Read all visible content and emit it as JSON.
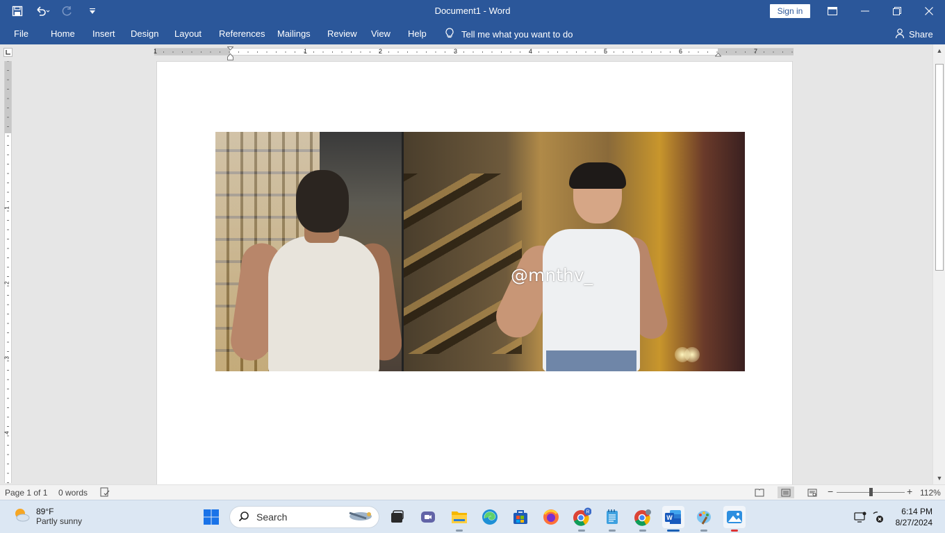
{
  "window": {
    "title": "Document1  -  Word",
    "sign_in": "Sign in"
  },
  "ribbon": {
    "tabs": [
      "File",
      "Home",
      "Insert",
      "Design",
      "Layout",
      "References",
      "Mailings",
      "Review",
      "View",
      "Help"
    ],
    "tell_me": "Tell me what you want to do",
    "share": "Share"
  },
  "ruler": {
    "h_labels": [
      "1",
      "1",
      "2",
      "3",
      "4",
      "5",
      "6",
      "7"
    ],
    "v_labels": [
      "1",
      "2",
      "3",
      "4"
    ]
  },
  "document": {
    "watermark_text": "@mnthv_"
  },
  "status": {
    "page": "Page 1 of 1",
    "words": "0 words",
    "zoom": "112%"
  },
  "taskbar": {
    "weather_temp": "89°F",
    "weather_cond": "Partly sunny",
    "search_label": "Search",
    "time": "6:14 PM",
    "date": "8/27/2024",
    "apps": [
      "start",
      "search",
      "task-view",
      "teams",
      "file-explorer",
      "edge",
      "store",
      "firefox",
      "chrome-r",
      "notepad",
      "chrome-w",
      "word",
      "paint",
      "photos"
    ]
  },
  "colors": {
    "word_blue": "#2b579a",
    "taskbar_bg": "#dce7f3"
  }
}
